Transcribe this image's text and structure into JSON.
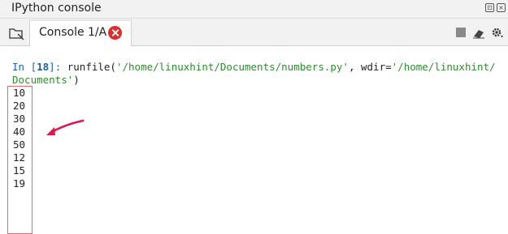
{
  "pane": {
    "title": "IPython console"
  },
  "tabs": [
    {
      "label": "Console 1/A"
    }
  ],
  "console": {
    "prompt_prefix": "In [",
    "prompt_number": "18",
    "prompt_suffix": "]: ",
    "cmd_func": "runfile(",
    "cmd_path": "'/home/linuxhint/Documents/numbers.py'",
    "cmd_sep": ", wdir=",
    "cmd_wdir_part1": "'/home/linuxhint/",
    "cmd_wdir_part2": "Documents'",
    "cmd_close": ")",
    "output": [
      "10",
      "20",
      "30",
      "40",
      "50",
      "12",
      "15",
      "19"
    ]
  },
  "icons": {
    "browse": "folder-browse-icon",
    "close_tab": "close-tab-icon",
    "stop": "stop-icon",
    "clear": "eraser-icon",
    "options": "gear-icon",
    "annotation": "red-arrow-annotation"
  },
  "colors": {
    "prompt": "#1f5fa8",
    "string": "#2e8b2e",
    "close_button": "#d9302c",
    "annotation": "#e0174f"
  }
}
